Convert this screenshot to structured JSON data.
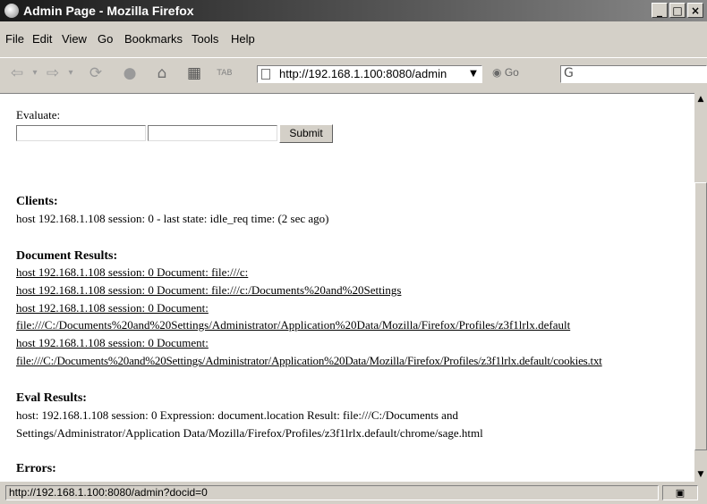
{
  "window": {
    "title": "Admin Page - Mozilla Firefox",
    "minimize": "_",
    "maximize": "□",
    "close": "×"
  },
  "menu": {
    "file": "File",
    "edit": "Edit",
    "view": "View",
    "go": "Go",
    "bookmarks": "Bookmarks",
    "tools": "Tools",
    "help": "Help"
  },
  "toolbar": {
    "url": "http://192.168.1.100:8080/admin",
    "go_label": "Go",
    "search_glyph": "G",
    "icons": {
      "back": "back-icon",
      "forward": "forward-icon",
      "reload": "reload-icon",
      "stop": "stop-icon",
      "home": "home-icon",
      "grid": "grid-icon"
    },
    "tab_label": "TAB"
  },
  "page": {
    "evaluate_label": "Evaluate:",
    "input1_value": "",
    "input2_value": "",
    "submit_label": "Submit",
    "clients_heading": "Clients:",
    "clients_line": "host 192.168.1.108 session: 0 - last state: idle_req time: (2 sec ago)",
    "doc_results_heading": "Document Results:",
    "doc_links": [
      "host 192.168.1.108 session: 0 Document: file:///c:",
      "host 192.168.1.108 session: 0 Document: file:///c:/Documents%20and%20Settings",
      "host 192.168.1.108 session: 0 Document:",
      "file:///C:/Documents%20and%20Settings/Administrator/Application%20Data/Mozilla/Firefox/Profiles/z3f1lrlx.default",
      "host 192.168.1.108 session: 0 Document:",
      "file:///C:/Documents%20and%20Settings/Administrator/Application%20Data/Mozilla/Firefox/Profiles/z3f1lrlx.default/cookies.txt"
    ],
    "eval_results_heading": "Eval Results:",
    "eval_line1": "host: 192.168.1.108 session: 0 Expression: document.location Result: file:///C:/Documents and",
    "eval_line2": "Settings/Administrator/Application Data/Mozilla/Firefox/Profiles/z3f1lrlx.default/chrome/sage.html",
    "errors_heading": "Errors:"
  },
  "status": {
    "text": "http://192.168.1.100:8080/admin?docid=0"
  }
}
